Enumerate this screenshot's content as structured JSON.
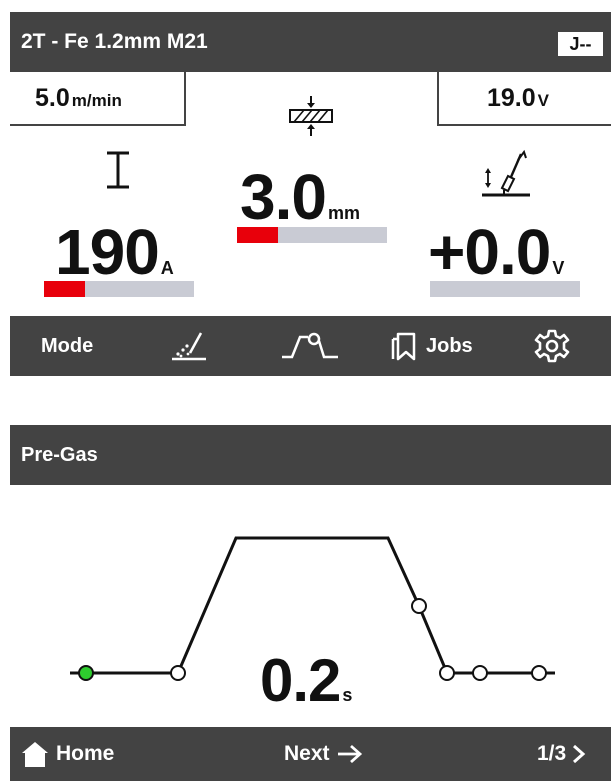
{
  "header": {
    "title": "2T - Fe 1.2mm M21",
    "job_badge": "J--"
  },
  "wire_speed": {
    "value": "5.0",
    "unit": "m/min"
  },
  "voltage_preset": {
    "value": "19.0",
    "unit": "V"
  },
  "material_thickness": {
    "icon": "thickness-icon",
    "value": "3.0",
    "unit": "mm",
    "level": 0.27
  },
  "current": {
    "icon": "current-icon",
    "value": "190",
    "unit": "A",
    "level": 0.27
  },
  "arc_length": {
    "icon": "arc-length-icon",
    "value": "+0.0",
    "unit": "V",
    "level": 0.0
  },
  "menu": {
    "mode_label": "Mode",
    "items": [
      {
        "name": "weld-process-icon"
      },
      {
        "name": "weld-sequence-icon"
      }
    ],
    "jobs_label": "Jobs",
    "settings_icon": "gear-icon"
  },
  "sequence": {
    "title": "Pre-Gas",
    "value": "0.2",
    "unit": "s"
  },
  "footer": {
    "home_label": "Home",
    "next_label": "Next",
    "page": "1/3"
  },
  "colors": {
    "bar_dark": "#434343",
    "level_red": "#e8000b",
    "track_gray": "#c9cbd4",
    "active_point": "#2ecc2e"
  }
}
